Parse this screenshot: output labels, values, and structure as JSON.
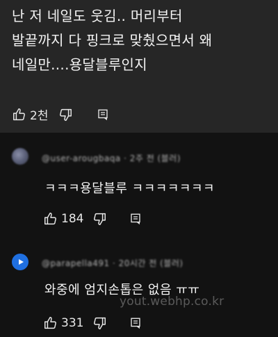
{
  "top_comment": {
    "text": "난 저 네일도 웃김.. 머리부터\n발끝까지 다 핑크로 맞췄으면서 왜\n네일만....용달블루인지",
    "like_count": "2천"
  },
  "replies": [
    {
      "handle": "@user-arougbaqa · 2주 전 (블러)",
      "text": "ㅋㅋㅋ용달블루 ㅋㅋㅋㅋㅋㅋㅋ",
      "like_count": "184"
    },
    {
      "handle": "@parapella491 · 20시간 전 (블러)",
      "text": "와중에 엄지손톱은 없음 ㅠㅠ",
      "like_count": "331"
    }
  ],
  "watermark": "yout.webhp.co.kr",
  "icons": [
    "thumbs-up-icon",
    "thumbs-down-icon",
    "reply-icon"
  ],
  "colors": {
    "background": "#121212",
    "top_comment_bg": "#262626",
    "text": "#f1f1f1",
    "avatar_blue": "#1f6fe0"
  }
}
